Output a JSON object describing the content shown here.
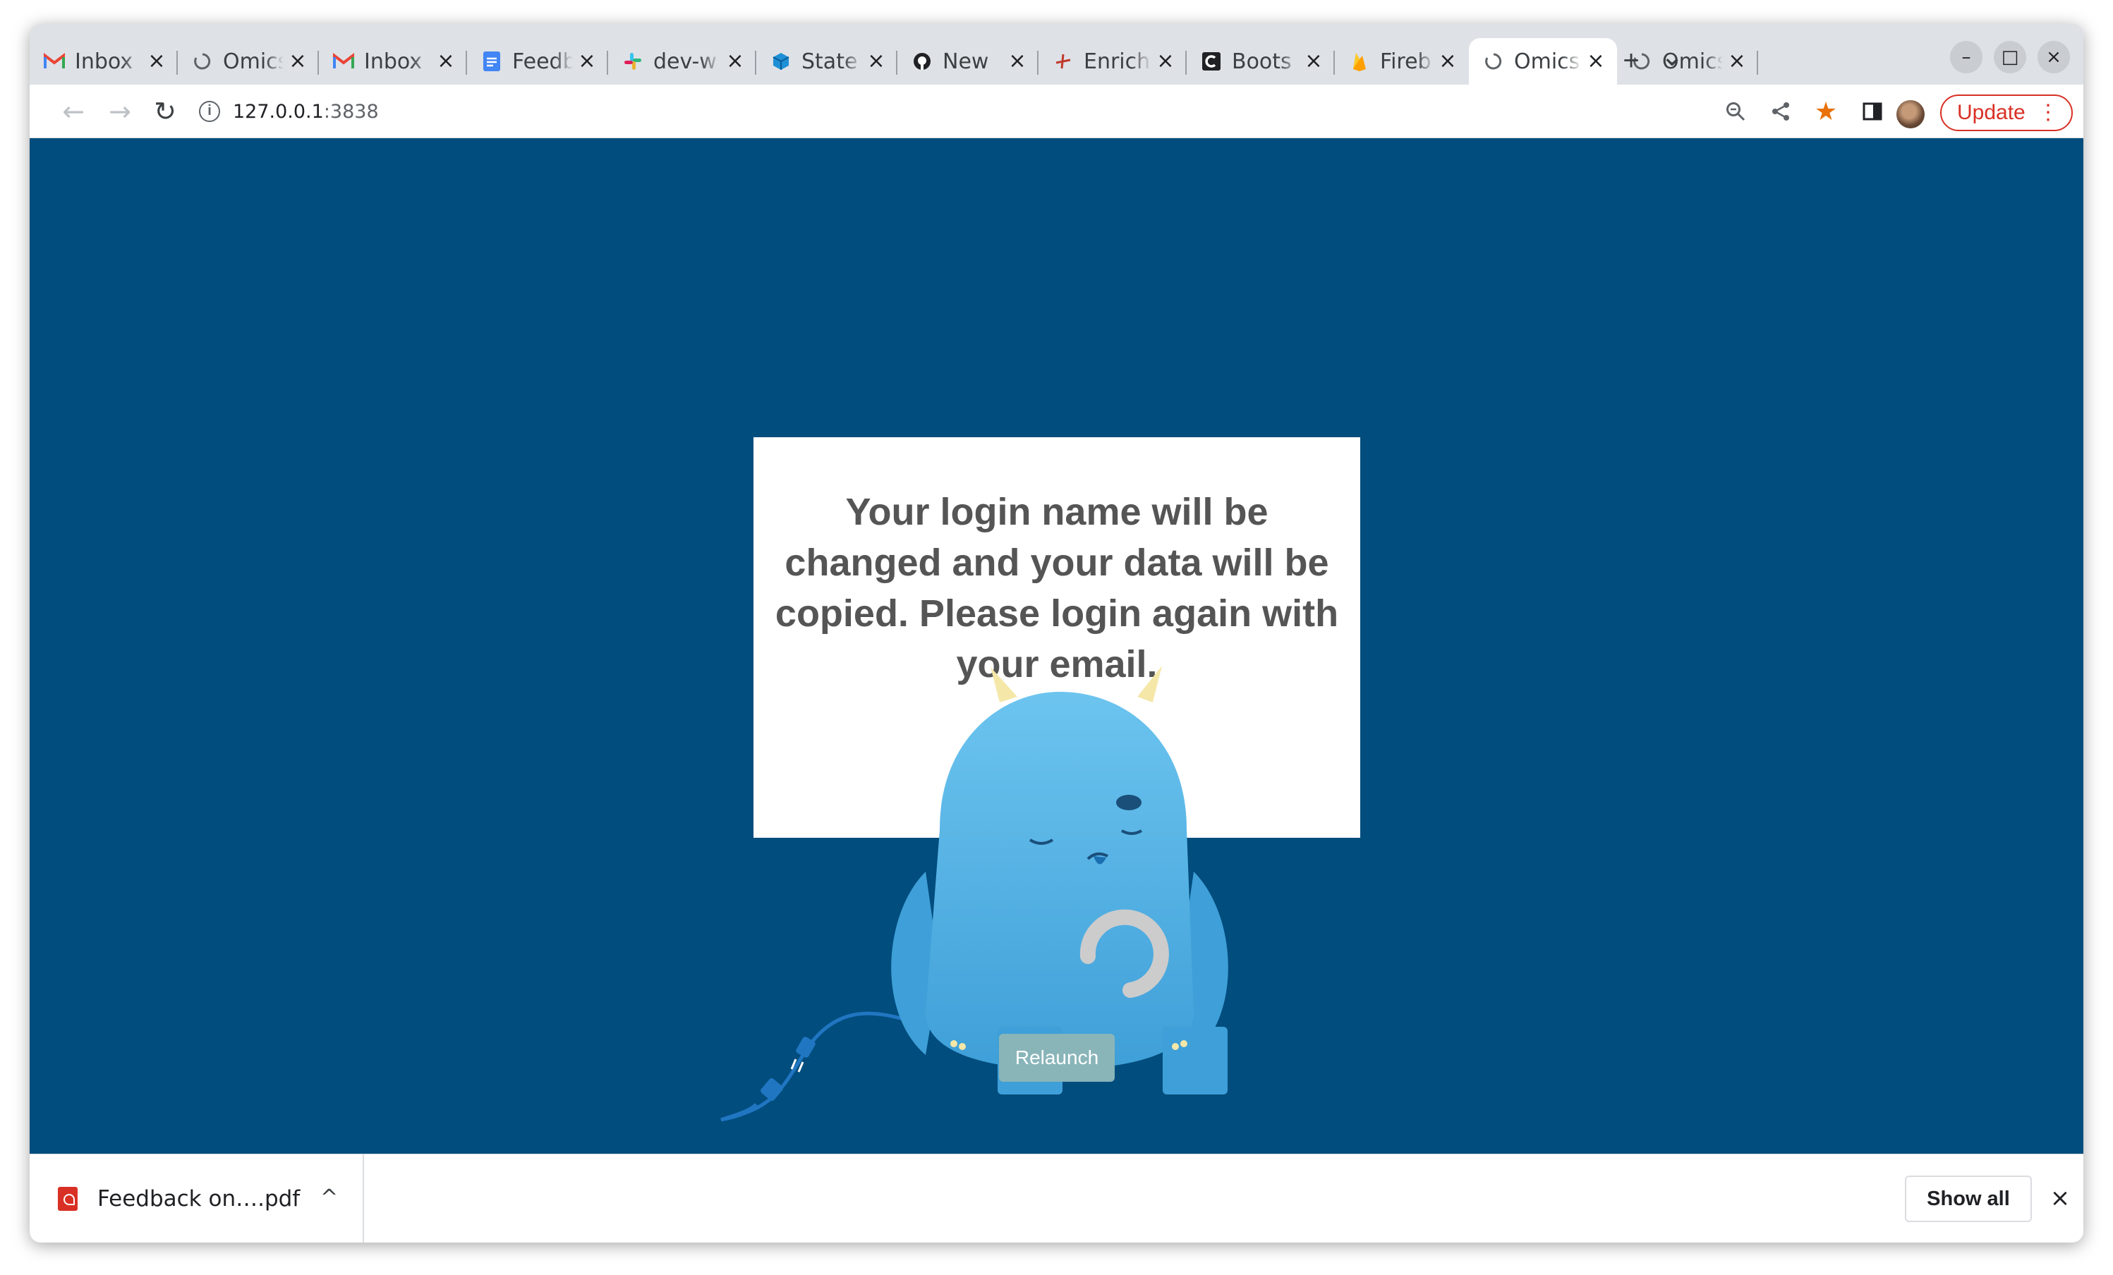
{
  "tabs": [
    {
      "title": "Inbox",
      "icon": "gmail-icon",
      "active": false
    },
    {
      "title": "Omics",
      "icon": "loading-icon",
      "active": false
    },
    {
      "title": "Inbox",
      "icon": "gmail-icon",
      "active": false
    },
    {
      "title": "Feedback",
      "icon": "google-docs-icon",
      "active": false
    },
    {
      "title": "dev-w",
      "icon": "slack-icon",
      "active": false
    },
    {
      "title": "State",
      "icon": "cube-icon",
      "active": false
    },
    {
      "title": "New",
      "icon": "github-icon",
      "active": false
    },
    {
      "title": "Enrich",
      "icon": "enrich-icon",
      "active": false
    },
    {
      "title": "Boots",
      "icon": "c-logo-icon",
      "active": false
    },
    {
      "title": "Fireb",
      "icon": "firebase-icon",
      "active": false
    },
    {
      "title": "Omics",
      "icon": "loading-icon",
      "active": true
    },
    {
      "title": "Omics",
      "icon": "loading-icon",
      "active": false
    }
  ],
  "tab_close_glyph": "×",
  "new_tab_glyph": "+",
  "tab_search_glyph": "⌄",
  "window_controls": {
    "minimize": "–",
    "maximize": "□",
    "close": "×"
  },
  "toolbar": {
    "back": "←",
    "forward": "→",
    "reload": "↻",
    "url_host": "127.0.0.1",
    "url_port": ":3838",
    "info_glyph": "i",
    "zoom_glyph": "⌕",
    "share_glyph": "⋖",
    "bookmark_glyph": "★",
    "sidepanel_glyph": "◧",
    "update_label": "Update",
    "menu_glyph": "⋮"
  },
  "colors": {
    "page_bg": "#004d7e",
    "dialog_text": "#555555",
    "relaunch_bg": "#89b5b9",
    "update_red": "#d93025",
    "bookmark_star": "#e8710a",
    "monster_blue": "#52b3e8"
  },
  "dialog": {
    "message": "Your login name will be changed and your data will be copied. Please login again with your email."
  },
  "relaunch_label": "Relaunch",
  "downloads": {
    "file_name": "Feedback on….pdf",
    "chevron": "^",
    "show_all": "Show all",
    "close": "×"
  }
}
